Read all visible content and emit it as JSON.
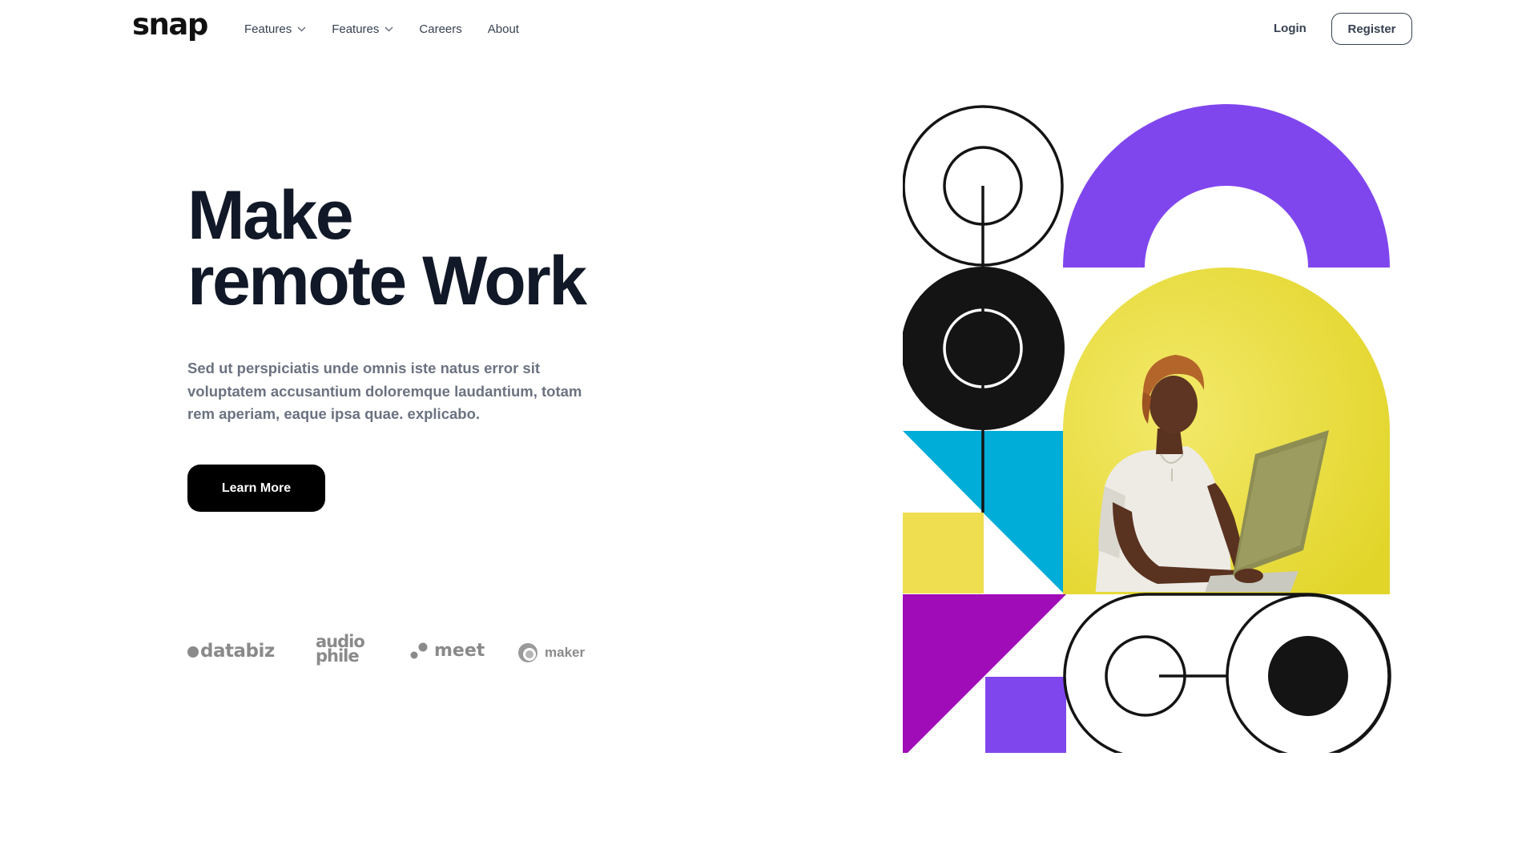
{
  "header": {
    "logo": "snap",
    "nav": [
      {
        "label": "Features",
        "has_dropdown": true,
        "icon": "chevron-down-icon"
      },
      {
        "label": "Features",
        "has_dropdown": true,
        "icon": "chevron-down-icon"
      },
      {
        "label": "Careers",
        "has_dropdown": false
      },
      {
        "label": "About",
        "has_dropdown": false
      }
    ],
    "login": "Login",
    "register": "Register"
  },
  "hero": {
    "title_line1": "Make",
    "title_line2": "remote Work",
    "description": "Sed ut perspiciatis unde omnis iste natus error sit voluptatem accusantium doloremque laudantium, totam rem aperiam, eaque ipsa quae. explicabo.",
    "cta": "Learn More"
  },
  "clients": {
    "databiz": "databiz",
    "audiophile_line1": "audio",
    "audiophile_line2": "phile",
    "meet": "meet",
    "maker": "maker"
  },
  "colors": {
    "purple": "#8046EE",
    "yellow_square": "#EEDE50",
    "yellow_photo": "#E6D93A",
    "cyan": "#00ACD8",
    "magenta": "#A00CB8",
    "black": "#141414",
    "text_dark": "#111827",
    "text_gray": "#6b7280",
    "logo_gray": "#8a8a8a"
  }
}
